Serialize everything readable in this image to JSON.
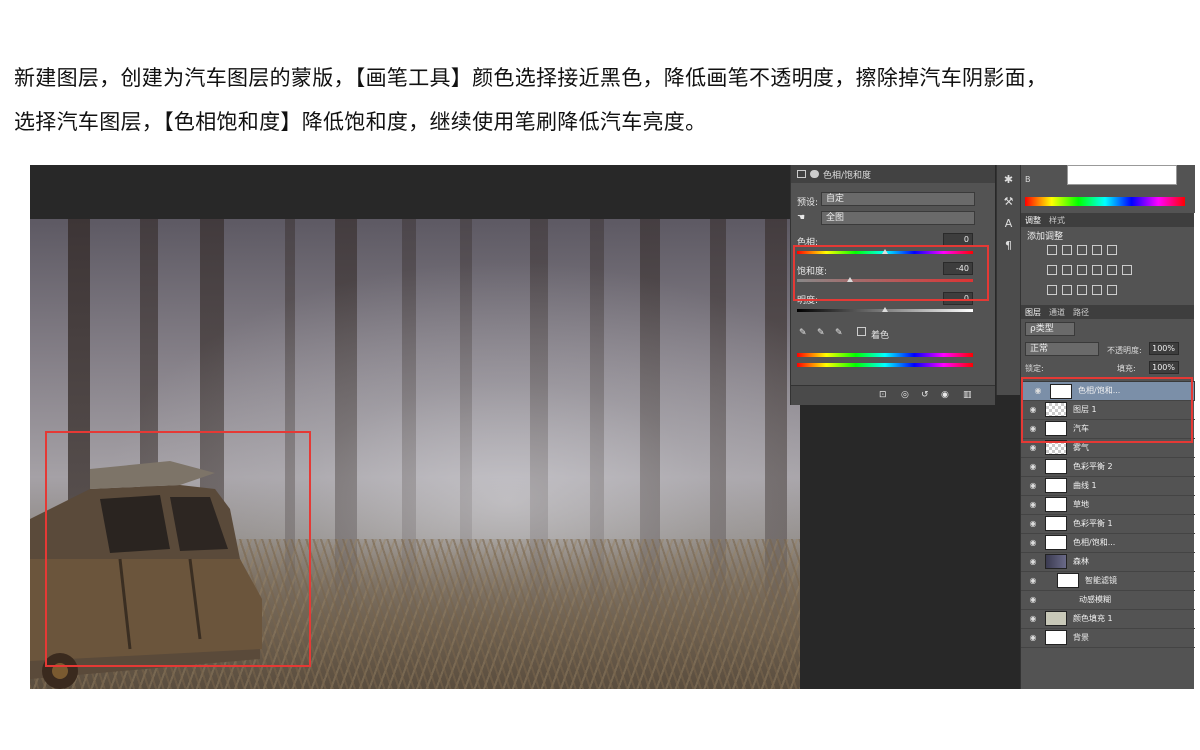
{
  "instructions": {
    "line1": "新建图层，创建为汽车图层的蒙版，【画笔工具】颜色选择接近黑色，降低画笔不透明度，擦除掉汽车阴影面，",
    "line2": "选择汽车图层，【色相饱和度】降低饱和度，继续使用笔刷降低汽车亮度。"
  },
  "properties_panel": {
    "title": "色相/饱和度",
    "preset_label": "预设:",
    "preset_value": "自定",
    "channel_value": "全图",
    "hue_label": "色相:",
    "hue_value": "0",
    "saturation_label": "饱和度:",
    "saturation_value": "-40",
    "saturation_fraction": 0.3,
    "lightness_label": "明度:",
    "lightness_value": "0",
    "colorize_label": "着色"
  },
  "right_panel": {
    "color_channel_label": "B",
    "tabs_top": [
      "调整",
      "样式"
    ],
    "adjustments_title": "添加调整",
    "tabs_layers": [
      "图层",
      "通道",
      "路径"
    ],
    "filter_kind": "ρ类型",
    "blend_mode": "正常",
    "opacity_label": "不透明度:",
    "opacity_value": "100%",
    "lock_label": "锁定:",
    "fill_label": "填充:",
    "fill_value": "100%",
    "layers": [
      {
        "name": "色相/饱和...",
        "thumb": "white",
        "selected": true
      },
      {
        "name": "图层 1",
        "thumb": "checker",
        "selected": false
      },
      {
        "name": "汽车",
        "thumb": "white",
        "selected": false
      },
      {
        "name": "雾气",
        "thumb": "checker",
        "selected": false
      },
      {
        "name": "色彩平衡 2",
        "thumb": "white",
        "selected": false
      },
      {
        "name": "曲线 1",
        "thumb": "white",
        "selected": false
      },
      {
        "name": "草地",
        "thumb": "white",
        "selected": false
      },
      {
        "name": "色彩平衡 1",
        "thumb": "white",
        "selected": false
      },
      {
        "name": "色相/饱和...",
        "thumb": "white",
        "selected": false
      },
      {
        "name": "森林",
        "thumb": "dark",
        "selected": false
      },
      {
        "name": "智能滤镜",
        "thumb": "white",
        "selected": false
      },
      {
        "name": "动感模糊",
        "thumb": "none",
        "selected": false
      },
      {
        "name": "颜色填充 1",
        "thumb": "grey",
        "selected": false
      },
      {
        "name": "背景",
        "thumb": "white",
        "selected": false
      }
    ]
  },
  "colors": {
    "highlight_box": "#e53935",
    "panel_bg": "#535353",
    "selected_layer": "#7b8fa8"
  }
}
